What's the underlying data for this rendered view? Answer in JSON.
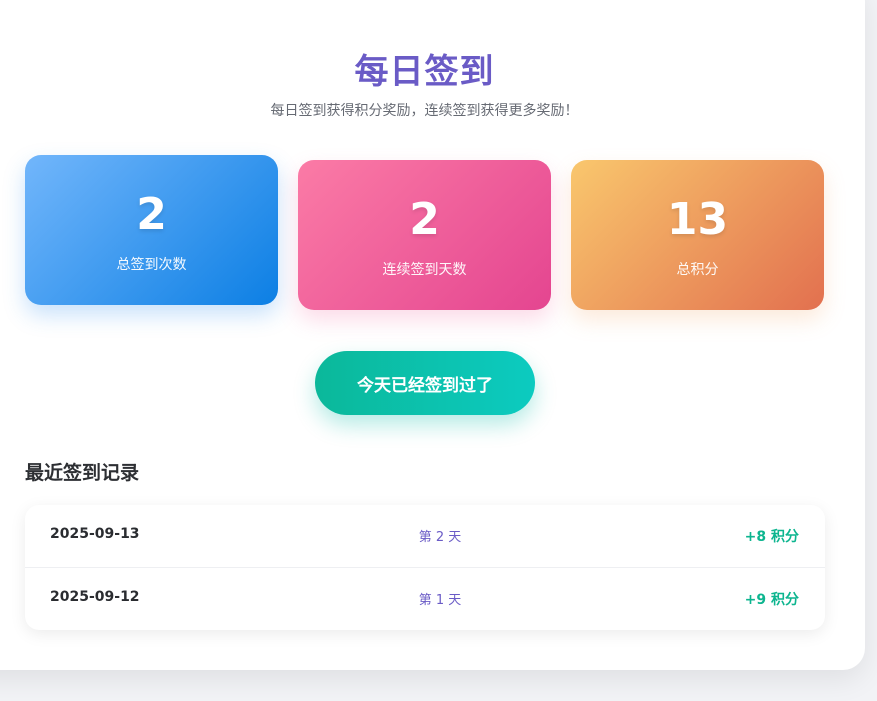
{
  "header": {
    "title": "每日签到",
    "subtitle": "每日签到获得积分奖励，连续签到获得更多奖励！"
  },
  "stats": [
    {
      "value": "2",
      "label": "总签到次数",
      "color": "#1e8ff0"
    },
    {
      "value": "2",
      "label": "连续签到天数",
      "color": "#f0609c"
    },
    {
      "value": "13",
      "label": "总积分",
      "color": "#ec9a5e"
    }
  ],
  "checkin_button": {
    "label": "今天已经签到过了",
    "color": "#0cc2ab"
  },
  "records": {
    "title": "最近签到记录",
    "items": [
      {
        "date": "2025-09-13",
        "day": "第 2 天",
        "points": "+8 积分"
      },
      {
        "date": "2025-09-12",
        "day": "第 1 天",
        "points": "+9 积分"
      }
    ]
  },
  "colors": {
    "accent": "#6a5bc6",
    "points": "#0db58f"
  }
}
